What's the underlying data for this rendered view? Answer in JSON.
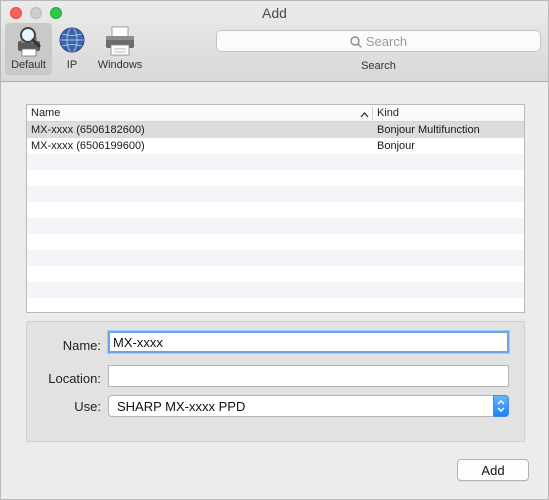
{
  "window": {
    "title": "Add"
  },
  "toolbar": {
    "items": [
      {
        "label": "Default",
        "icon": "magnifier-printer-icon",
        "selected": true
      },
      {
        "label": "IP",
        "icon": "globe-icon",
        "selected": false
      },
      {
        "label": "Windows",
        "icon": "printer-icon",
        "selected": false
      }
    ],
    "search": {
      "placeholder": "Search",
      "caption": "Search"
    }
  },
  "printer_list": {
    "columns": {
      "name": "Name",
      "kind": "Kind"
    },
    "sort_indicator": "ascending",
    "rows": [
      {
        "name": "MX-xxxx (6506182600)",
        "kind": "Bonjour Multifunction",
        "selected": true
      },
      {
        "name": "MX-xxxx (6506199600)",
        "kind": "Bonjour",
        "selected": false
      }
    ]
  },
  "form": {
    "name_label": "Name:",
    "name_value": "MX-xxxx",
    "location_label": "Location:",
    "location_value": "",
    "use_label": "Use:",
    "use_value": "SHARP MX-xxxx PPD"
  },
  "actions": {
    "add_label": "Add"
  },
  "colors": {
    "close": "#fc605c",
    "minimize": "#cfcfcf",
    "zoom": "#34c84a",
    "focus_ring": "#6aa5e8",
    "select_arrow": "#1a82fb"
  }
}
